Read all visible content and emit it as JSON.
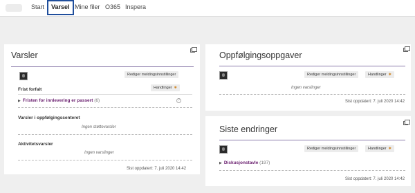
{
  "nav": {
    "items": [
      "Start",
      "Varsel",
      "Mine filer",
      "O365",
      "Inspera"
    ],
    "active": "Varsel"
  },
  "varsler": {
    "title": "Varsler",
    "edit_button": "Rediger meldingsinnstillinger",
    "actions_button": "Handlinger",
    "frist_label": "Frist forfalt",
    "frist_link": "Fristen for innlevering er passert",
    "frist_count": "(6)",
    "oppfolging_label": "Varsler i oppfølgingssenteret",
    "oppfolging_empty": "Ingen støttevarsler",
    "aktivitet_label": "Aktivitetsvarsler",
    "aktivitet_empty": "Ingen varslinger",
    "updated": "Sist oppdatert: 7. juli 2020 14:42"
  },
  "oppgaver": {
    "title": "Oppfølgingsoppgaver",
    "edit_button": "Rediger meldingsinnstillinger",
    "actions_button": "Handlinger",
    "empty": "Ingen varslinger",
    "updated": "Sist oppdatert: 7. juli 2020 14:42"
  },
  "endringer": {
    "title": "Siste endringer",
    "edit_button": "Rediger meldingsinnstillinger",
    "actions_button": "Handlinger",
    "link": "Diskusjonstavle",
    "count": "(197)",
    "updated": "Sist oppdatert: 7. juli 2020 14:42"
  },
  "colors": {
    "accent_border": "#1f4e9c",
    "link": "#6a1f6f",
    "title_underline": "#8a7aaa"
  },
  "icons": {
    "caret": "caret-down-icon",
    "window": "maximize-window-icon",
    "help": "help-icon",
    "expand": "triangle-right-icon"
  }
}
